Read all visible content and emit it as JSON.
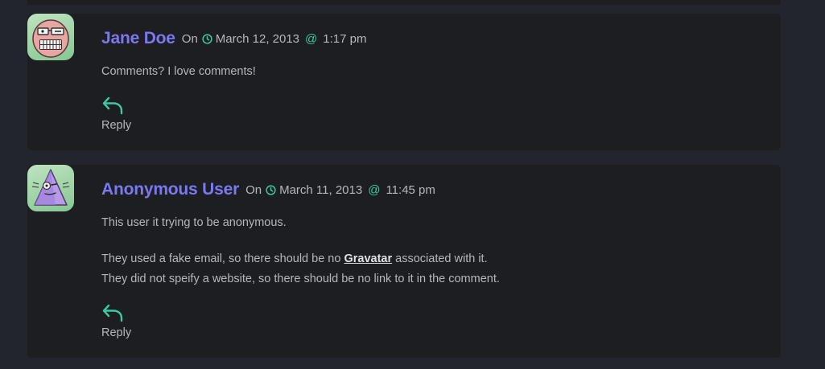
{
  "colors": {
    "page_background": "#22252b",
    "card_background": "#1c1e22",
    "author_name": "#7b78f0",
    "accent_teal": "#3cc9a4",
    "text": "#b4b8be"
  },
  "comments": [
    {
      "author": "Jane Doe",
      "on_label": "On",
      "date": "March 12, 2013",
      "at_label": "@",
      "time": "1:17 pm",
      "avatar_icon": "robot-face-avatar-icon",
      "paragraphs": [
        "Comments? I love comments!"
      ],
      "reply_label": "Reply"
    },
    {
      "author": "Anonymous User",
      "on_label": "On",
      "date": "March 11, 2013",
      "at_label": "@",
      "time": "11:45 pm",
      "avatar_icon": "triangle-creature-avatar-icon",
      "paragraph1": "This user it trying to be anonymous.",
      "paragraph2": {
        "line1_before": "They used a fake email, so there should be no ",
        "link_text": "Gravatar",
        "line1_after": " associated with it.",
        "line2": "They did not speify a website, so there should be no link to it in the comment."
      },
      "reply_label": "Reply"
    }
  ]
}
